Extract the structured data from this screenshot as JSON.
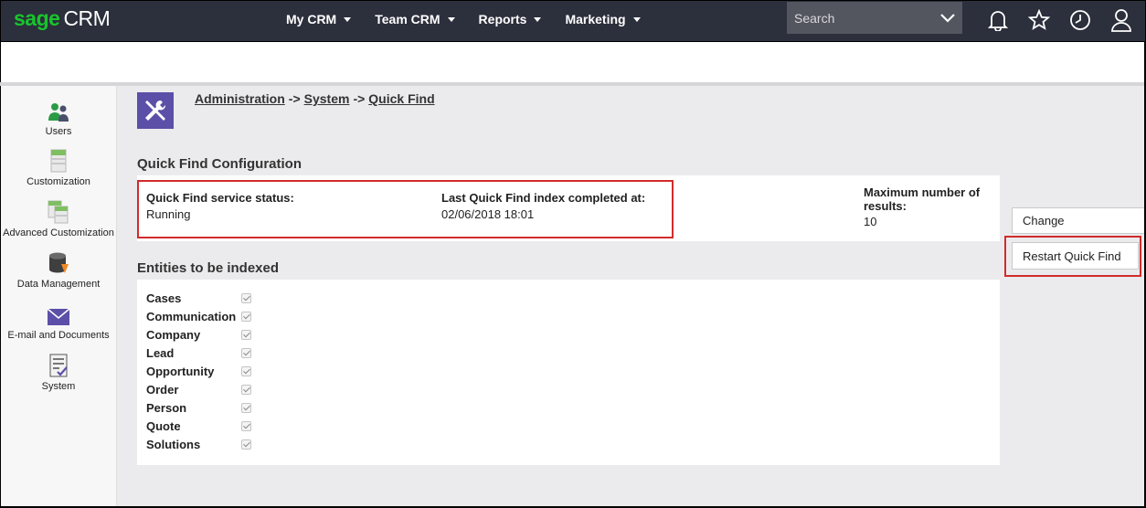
{
  "header": {
    "logo_sage": "sage",
    "logo_crm": "CRM",
    "nav": [
      {
        "label": "My CRM"
      },
      {
        "label": "Team CRM"
      },
      {
        "label": "Reports"
      },
      {
        "label": "Marketing"
      }
    ],
    "search_placeholder": "Search",
    "icons": [
      "bell-icon",
      "star-icon",
      "clock-icon",
      "user-icon"
    ]
  },
  "sidebar": {
    "items": [
      {
        "label": "Users",
        "icon": "users-icon"
      },
      {
        "label": "Customization",
        "icon": "customization-icon"
      },
      {
        "label": "Advanced Customization",
        "icon": "advanced-customization-icon"
      },
      {
        "label": "Data Management",
        "icon": "database-icon"
      },
      {
        "label": "E-mail and Documents",
        "icon": "envelope-icon"
      },
      {
        "label": "System",
        "icon": "system-icon"
      }
    ]
  },
  "breadcrumb": {
    "items": [
      "Administration",
      "System",
      "Quick Find"
    ],
    "separator": "->"
  },
  "config": {
    "title": "Quick Find Configuration",
    "status_label": "Quick Find service status:",
    "status_value": "Running",
    "last_index_label": "Last Quick Find index completed at:",
    "last_index_value": "02/06/2018 18:01",
    "max_results_label": "Maximum number of results:",
    "max_results_value": "10"
  },
  "entities": {
    "title": "Entities to be indexed",
    "items": [
      {
        "name": "Cases",
        "checked": true
      },
      {
        "name": "Communication",
        "checked": true
      },
      {
        "name": "Company",
        "checked": true
      },
      {
        "name": "Lead",
        "checked": true
      },
      {
        "name": "Opportunity",
        "checked": true
      },
      {
        "name": "Order",
        "checked": true
      },
      {
        "name": "Person",
        "checked": true
      },
      {
        "name": "Quote",
        "checked": true
      },
      {
        "name": "Solutions",
        "checked": true
      }
    ]
  },
  "actions": {
    "change_label": "Change",
    "restart_label": "Restart Quick Find"
  },
  "colors": {
    "topbar": "#2c2f3c",
    "brand_green": "#17c52c",
    "admin_purple": "#5b4fa8",
    "highlight_red": "#d22b2b"
  }
}
